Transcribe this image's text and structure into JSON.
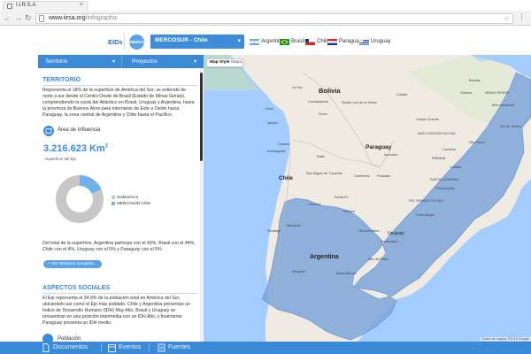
{
  "browser": {
    "tab_title": "I.I.R.S.A.",
    "tab_close": "×",
    "url_host": "www.iirsa.org",
    "url_path": "/infographic",
    "back_glyph": "←",
    "forward_glyph": "→",
    "reload_glyph": "↻",
    "star_glyph": "☆",
    "menu_glyph": "⋮"
  },
  "header": {
    "eids_label": "EIDs",
    "badge_text": "MERCOSUR",
    "eje_selected": "MERCOSUR - Chile",
    "countries": [
      {
        "name": "Argentina"
      },
      {
        "name": "Brasil"
      },
      {
        "name": "Chile"
      },
      {
        "name": "Paraguay"
      },
      {
        "name": "Uruguay"
      }
    ]
  },
  "panel": {
    "tab_territorio": "Territorio",
    "tab_proyectos": "Proyectos",
    "section1_title": "TERRITORIO",
    "section1_text": "Representa el 18% de la superficie de América del Sur, se extiende de norte a sur desde el Centro Oeste de Brasil (Estado de Minas Gerais), comprendiendo la costa del Atlántico en Brasil, Uruguay y Argentina, hasta la provincia de Buenos Aires para internarse de Este a Oeste hacia Paraguay, la zona central de Argentina y Chile hasta el Pacífico.",
    "area_label": "Área de Influencia",
    "area_value": "3.216.623 Km",
    "area_exp": "2",
    "area_sub": "Superficie del Eje",
    "legend": [
      {
        "label": "Sudamérica",
        "color": "#c7c7c7"
      },
      {
        "label": "MERCOSUR-Chile",
        "color": "#6fb1ea"
      }
    ],
    "donut_share_pct": 18,
    "dist_text": "Del total de la superficie, Argentina participa con el 43%, Brasil con el 44%, Chile con el 4%, Uruguay con el 5% y Paraguay con el 5%.",
    "territory_button": "+ Ver Territorio completo",
    "section2_title": "ASPECTOS SOCIALES",
    "section2_text": "El Eje representa el 34.9% de la población total en América del Sur, ubicándolo así como el Eje más poblado. Chile y Argentina presentan un Índice de Desarrollo Humano (IDH) Muy Alto, Brasil y Uruguay se encuentran en una posición intermedia con un IDH Alto, y finalmente Paraguay presenta un IDH medio.",
    "bottom_label": "Población"
  },
  "map": {
    "style_map": "Map Style",
    "style_plain": "Mapa",
    "attribution": "Datos de mapas ©2018 Google",
    "labels": {
      "bolivia": "Bolivia",
      "paraguay": "Paraguay",
      "chile": "Chile",
      "argentina": "Argentina",
      "uruguay": "Uruguay",
      "la_paz": "La Paz",
      "cochabamba": "Cochabamba",
      "santa_cruz": "Santa Cruz de la Sierra",
      "sucre": "Sucre",
      "arica": "Arica",
      "iquique": "Iquique",
      "antofagasta": "Antofagasta",
      "calama": "Calama",
      "salta": "Salta",
      "tucuman": "San Miguel de Tucumán",
      "asuncion": "Asunción",
      "campo_grande": "Campo Grande",
      "londrina": "Londrina",
      "sao_paulo": "São Paulo",
      "curitiba": "Curitiba",
      "florianopolis": "Florianópolis",
      "porto_alegre": "Porto Alegre",
      "rio_grande_do_sul": "RIO GRANDE DO SUL",
      "santa_catarina": "SANTA CATARINA",
      "parana": "PARANÁ",
      "cordoba": "Córdoba",
      "rosario": "Rosario",
      "mendoza": "Mendoza",
      "buenos_aires": "Buenos Aires",
      "montevideo": "Montevideo",
      "santiago": "Santiago",
      "mar_del_plata": "Mar del Plata",
      "neuquen": "Neuquén",
      "bahia_blanca": "Bahía Blanca",
      "posadas": "Posadas",
      "corrientes": "Corrientes",
      "santa_fe": "Santa Fe",
      "cuiaba": "Cuiabá",
      "brasilia": "Brasília",
      "goiania": "Goiânia",
      "belo_horizonte": "Belo Horizonte",
      "rio": "Rio de Janeiro",
      "mato_grosso_do_sul": "MATO GROSSO DO SUL",
      "minas_gerais": "MINAS GERAIS"
    }
  },
  "footer": {
    "documentos": "Documentos",
    "eventos": "Eventos",
    "fuentes": "Fuentes"
  },
  "colors": {
    "brand_blue": "#3b8ad8",
    "highlight": "#7fa6db",
    "ocean": "#a3ccff",
    "land": "#efebe2"
  }
}
